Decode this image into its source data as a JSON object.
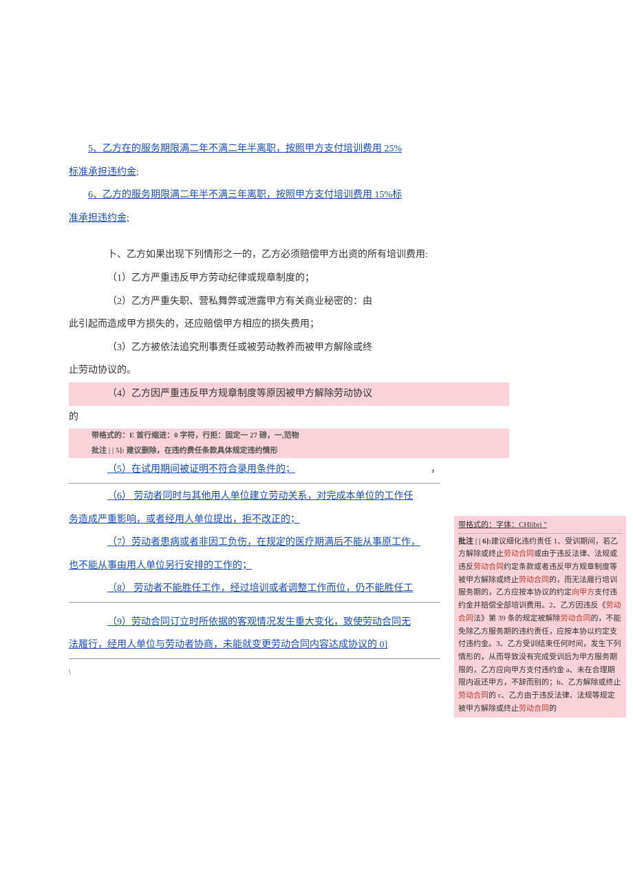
{
  "clauses": {
    "c5a": "5、乙方在的服务期限满二年不满二年半离职，按照甲方支付培训费用 25%",
    "c5b": "标准承担违约金;",
    "c6a": "6、乙方的服务期限满二年半不满三年离职，按照甲方支付培训费用 15%标",
    "c6b": "准承担违约金;",
    "bHead": "卜、乙方如果出现下列情形之一的，乙方必须赔偿甲方出资的所有培训费用:",
    "b1": "（1）乙方严重违反甲方劳动纪律或规章制度的；",
    "b2": "（2）乙方严重失职、营私舞弊或泄露甲方有关商业秘密的：由",
    "b2tail": "此引起而造成甲方损失的，还应赔偿甲方相应的损失费用；",
    "b3": "（3）乙方被依法追究刑事责任或被劳动教养而被甲方解除或终",
    "b3tail": "止劳动协议的。",
    "b4": "（4）乙方因严重违反甲方规章制度等原因被甲方解除劳动协议",
    "b4tail": "的",
    "fmt1": "带格式的：E 首行缩进：0 字符，行拒：固定一 27 磅，一,范物",
    "cmt5": "批注 | | 5]: 建议删除，在违约费任条款具体规定违约情形",
    "b5": "（5）在试用期间被证明不符合录用条件的；",
    "b5comma": "，",
    "b6a": "（6） 劳动者同时与其他用人单位建立劳动关系，对完成本单位的工作任",
    "b6b": "务造成严重影响，或者经用人单位提出，拒不改正的；",
    "b7a": "（7）劳动者患病或者非因工负伤，在规定的医疗期满后不能从事原工作，",
    "b7b": "也不能从事由用人单位另行安排的工作的；",
    "b8": "（8） 劳动者不能胜任工作，经过培训或者调整工作而位，仍不能胜任工",
    "b9a": "（9）劳动合同订立时所依据的客观情况发生重大变化，致使劳动合同无",
    "b9b": "法履行，经用人单位与劳动者协商，未能就变更劳动合同内容达成协议的 0]"
  },
  "comment6": {
    "fmt": "带格式的：字体：CHlibri           \"",
    "head": "批注 | | 6]:",
    "body": "建议细化违约责任 1、受训期间，若乙方解除或终止劳动合同或由于违反法律、法规或违反劳动合同约定条款或者违反甲方规章制度等被甲方解除或终止劳动合同的，而无法履行培训服务期的，乙方应按本协议的约定向甲方支付违约金并赔偿全部培训费用。2、乙方因违反《劳动合同法》第 39 条的规定被解除劳动合同的，不能免除乙方服务期的违约责任，应按本协以约定支付违约金。3、乙方受训结束任何时间，发生下列情形的，从而导致没有完成受训后为甲方服务期限的，乙方应向甲方支付违约金 a、未在合理期限内返还甲方，不辞而别的；b、乙方解除或终止劳动合同的 c、乙方由于违反法律、法规等规定被甲方解除或终止劳动合同的",
    "hi1": "合同",
    "hi2": "向甲方",
    "hi3": "合同",
    "hi4": "合同"
  },
  "footer": "\\"
}
